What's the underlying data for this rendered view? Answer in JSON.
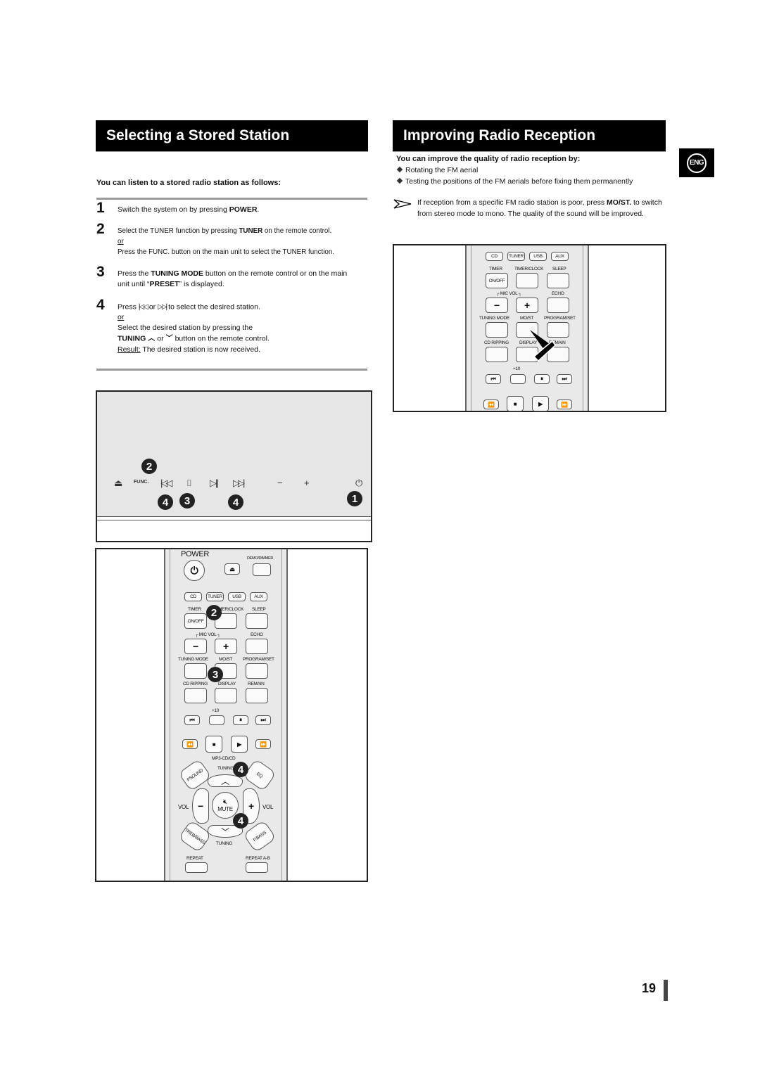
{
  "left_section": {
    "title": "Selecting a Stored Station",
    "intro": "You can listen to a stored radio station as follows:",
    "steps": [
      {
        "num": "1",
        "text_pre": "Switch the system on by pressing ",
        "bold": "POWER",
        "text_post": "."
      },
      {
        "num": "2",
        "line1_pre": "Select the TUNER function by pressing ",
        "line1_bold": "TUNER",
        "line1_post": " on the remote control.",
        "or": "or",
        "line2": "Press the FUNC. button on the main unit to select the TUNER function."
      },
      {
        "num": "3",
        "pre": "Press the ",
        "bold1": "TUNING MODE",
        "mid": " button on the remote control or on the main unit until “",
        "bold2": "PRESET",
        "post": "” is displayed."
      },
      {
        "num": "4",
        "line1_pre": "Press",
        "icon_prev": "skip-back-icon",
        "line1_or": "or",
        "icon_next": "skip-forward-icon",
        "line1_post": "to select the desired station.",
        "or": "or",
        "line2": "Select the desired station by pressing the",
        "line3_bold": "TUNING",
        "icon_up": "chevron-up-icon",
        "line3_or": "or",
        "icon_down": "chevron-down-icon",
        "line3_post": "button on the remote control.",
        "result_label": "Result:",
        "result_text": " The desired station is now received."
      }
    ],
    "front_panel": {
      "controls": [
        "eject",
        "FUNC.",
        "prev",
        "stop",
        "play-pause",
        "next",
        "−",
        "+",
        "power"
      ],
      "func_label": "FUNC.",
      "minus": "−",
      "plus": "+",
      "callouts": [
        "2",
        "4",
        "3",
        "4",
        "1"
      ]
    },
    "remote": {
      "power_label": "POWER",
      "demo_label": "DEMO/DIMMER",
      "source_buttons": [
        "CD",
        "TUNER",
        "USB",
        "AUX"
      ],
      "row2_labels": [
        "TIMER",
        "TIMER/CLOCK",
        "SLEEP"
      ],
      "onoff": "ON/OFF",
      "mic_vol": "┌ MIC VOL ┐",
      "echo": "ECHO",
      "minus": "−",
      "plus": "+",
      "row4_labels": [
        "TUNING MODE",
        "MO/ST",
        "PROGRAM/SET"
      ],
      "row5_labels": [
        "CD RIPPING",
        "DISPLAY",
        "REMAIN"
      ],
      "plus10": "+10",
      "transport1": [
        "⏮",
        "",
        "⏸",
        "⏭"
      ],
      "transport2": [
        "⏪",
        "■",
        "▶",
        "⏩"
      ],
      "mp3": "MP3-CD/CD",
      "psound": "PSOUND",
      "tuning": "TUNING",
      "eq": "EQ",
      "vol": "VOL",
      "mute": "MUTE",
      "treb": "TREB/BASS",
      "pbass": "P.BASS",
      "repeat": "REPEAT",
      "repeat_ab": "REPEAT A-B",
      "callouts": [
        "2",
        "3",
        "4",
        "4"
      ]
    }
  },
  "right_section": {
    "title": "Improving Radio Reception",
    "intro": "You can improve the quality of radio reception by:",
    "bullets": [
      "Rotating the FM aerial",
      "Testing the positions of the FM aerials before fixing them permanently"
    ],
    "note_pre": "If reception from a specific FM radio station is poor, press ",
    "note_bold": "MO/ST.",
    "note_post": " to switch from stereo mode to mono. The quality of the sound will be improved.",
    "remote": {
      "source_buttons": [
        "CD",
        "TUNER",
        "USB",
        "AUX"
      ],
      "row2_labels": [
        "TIMER",
        "TIMER/CLOCK",
        "SLEEP"
      ],
      "onoff": "ON/OFF",
      "mic_vol": "┌ MIC VOL ┐",
      "echo": "ECHO",
      "minus": "−",
      "plus": "+",
      "row4_labels": [
        "TUNING MODE",
        "MO/ST",
        "PROGRAM/SET"
      ],
      "row5_labels": [
        "CD RIPPING",
        "DISPLAY",
        "REMAIN"
      ],
      "plus10": "+10",
      "transport1": [
        "⏮",
        "",
        "⏸",
        "⏭"
      ],
      "transport2": [
        "⏪",
        "■",
        "▶",
        "⏩"
      ]
    }
  },
  "language_badge": "ENG",
  "page_number": "19"
}
